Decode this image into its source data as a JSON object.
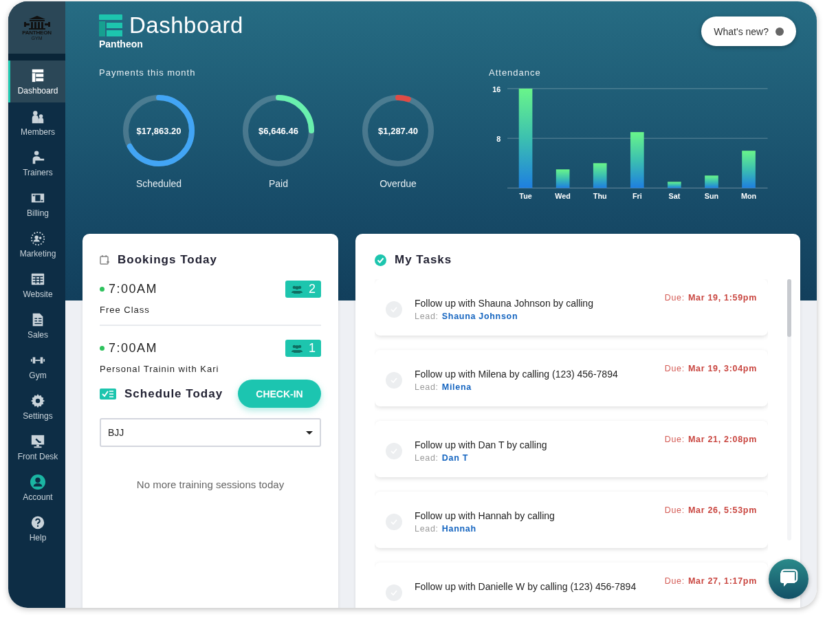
{
  "logo": {
    "name": "PANTHEON",
    "sub": "GYM"
  },
  "sidebar": {
    "items": [
      {
        "label": "Dashboard",
        "selected": true
      },
      {
        "label": "Members",
        "selected": false
      },
      {
        "label": "Trainers",
        "selected": false
      },
      {
        "label": "Billing",
        "selected": false
      },
      {
        "label": "Marketing",
        "selected": false
      },
      {
        "label": "Website",
        "selected": false
      },
      {
        "label": "Sales",
        "selected": false
      },
      {
        "label": "Gym",
        "selected": false
      },
      {
        "label": "Settings",
        "selected": false
      },
      {
        "label": "Front Desk",
        "selected": false
      },
      {
        "label": "Account",
        "selected": false
      },
      {
        "label": "Help",
        "selected": false
      }
    ]
  },
  "header": {
    "title": "Dashboard",
    "subtitle": "Pantheon",
    "whats_new": "What's new?"
  },
  "payments": {
    "title": "Payments this month",
    "items": [
      {
        "amount": "$17,863.20",
        "label": "Scheduled",
        "level": 0.67,
        "color": "#42a5f5"
      },
      {
        "amount": "$6,646.46",
        "label": "Paid",
        "level": 0.25,
        "color": "#69f0ae"
      },
      {
        "amount": "$1,287.40",
        "label": "Overdue",
        "level": 0.05,
        "color": "#e04b45"
      }
    ]
  },
  "attendance": {
    "title": "Attendance",
    "chart_data": {
      "type": "bar",
      "categories": [
        "Tue",
        "Wed",
        "Thu",
        "Fri",
        "Sat",
        "Sun",
        "Mon"
      ],
      "values": [
        16,
        3,
        4,
        9,
        1,
        2,
        6
      ],
      "ylim": [
        0,
        16
      ],
      "yticks": [
        8,
        16
      ]
    }
  },
  "bookings": {
    "title": "Bookings Today",
    "items": [
      {
        "time": "7:00AM",
        "name": "Free Class",
        "count": "2"
      },
      {
        "time": "7:00AM",
        "name": "Personal Trainin with Kari",
        "count": "1"
      }
    ]
  },
  "schedule": {
    "title": "Schedule Today",
    "button": "CHECK-IN",
    "select": "BJJ",
    "empty": "No more training sessions today"
  },
  "tasks": {
    "title": "My Tasks",
    "items": [
      {
        "text": "Follow up with Shauna Johnson by calling",
        "lead_label": "Lead:",
        "lead": "Shauna Johnson",
        "due_label": "Due:",
        "due": "Mar 19, 1:59pm"
      },
      {
        "text": "Follow up with Milena by calling (123) 456-7894",
        "lead_label": "Lead:",
        "lead": "Milena",
        "due_label": "Due:",
        "due": "Mar 19, 3:04pm"
      },
      {
        "text": "Follow up with Dan T by calling",
        "lead_label": "Lead:",
        "lead": "Dan T",
        "due_label": "Due:",
        "due": "Mar 21, 2:08pm"
      },
      {
        "text": "Follow up with Hannah by calling",
        "lead_label": "Lead:",
        "lead": "Hannah",
        "due_label": "Due:",
        "due": "Mar 26, 5:53pm"
      },
      {
        "text": "Follow up with Danielle W by calling (123) 456-7894",
        "due_label": "Due:",
        "due": "Mar 27, 1:17pm"
      }
    ]
  }
}
